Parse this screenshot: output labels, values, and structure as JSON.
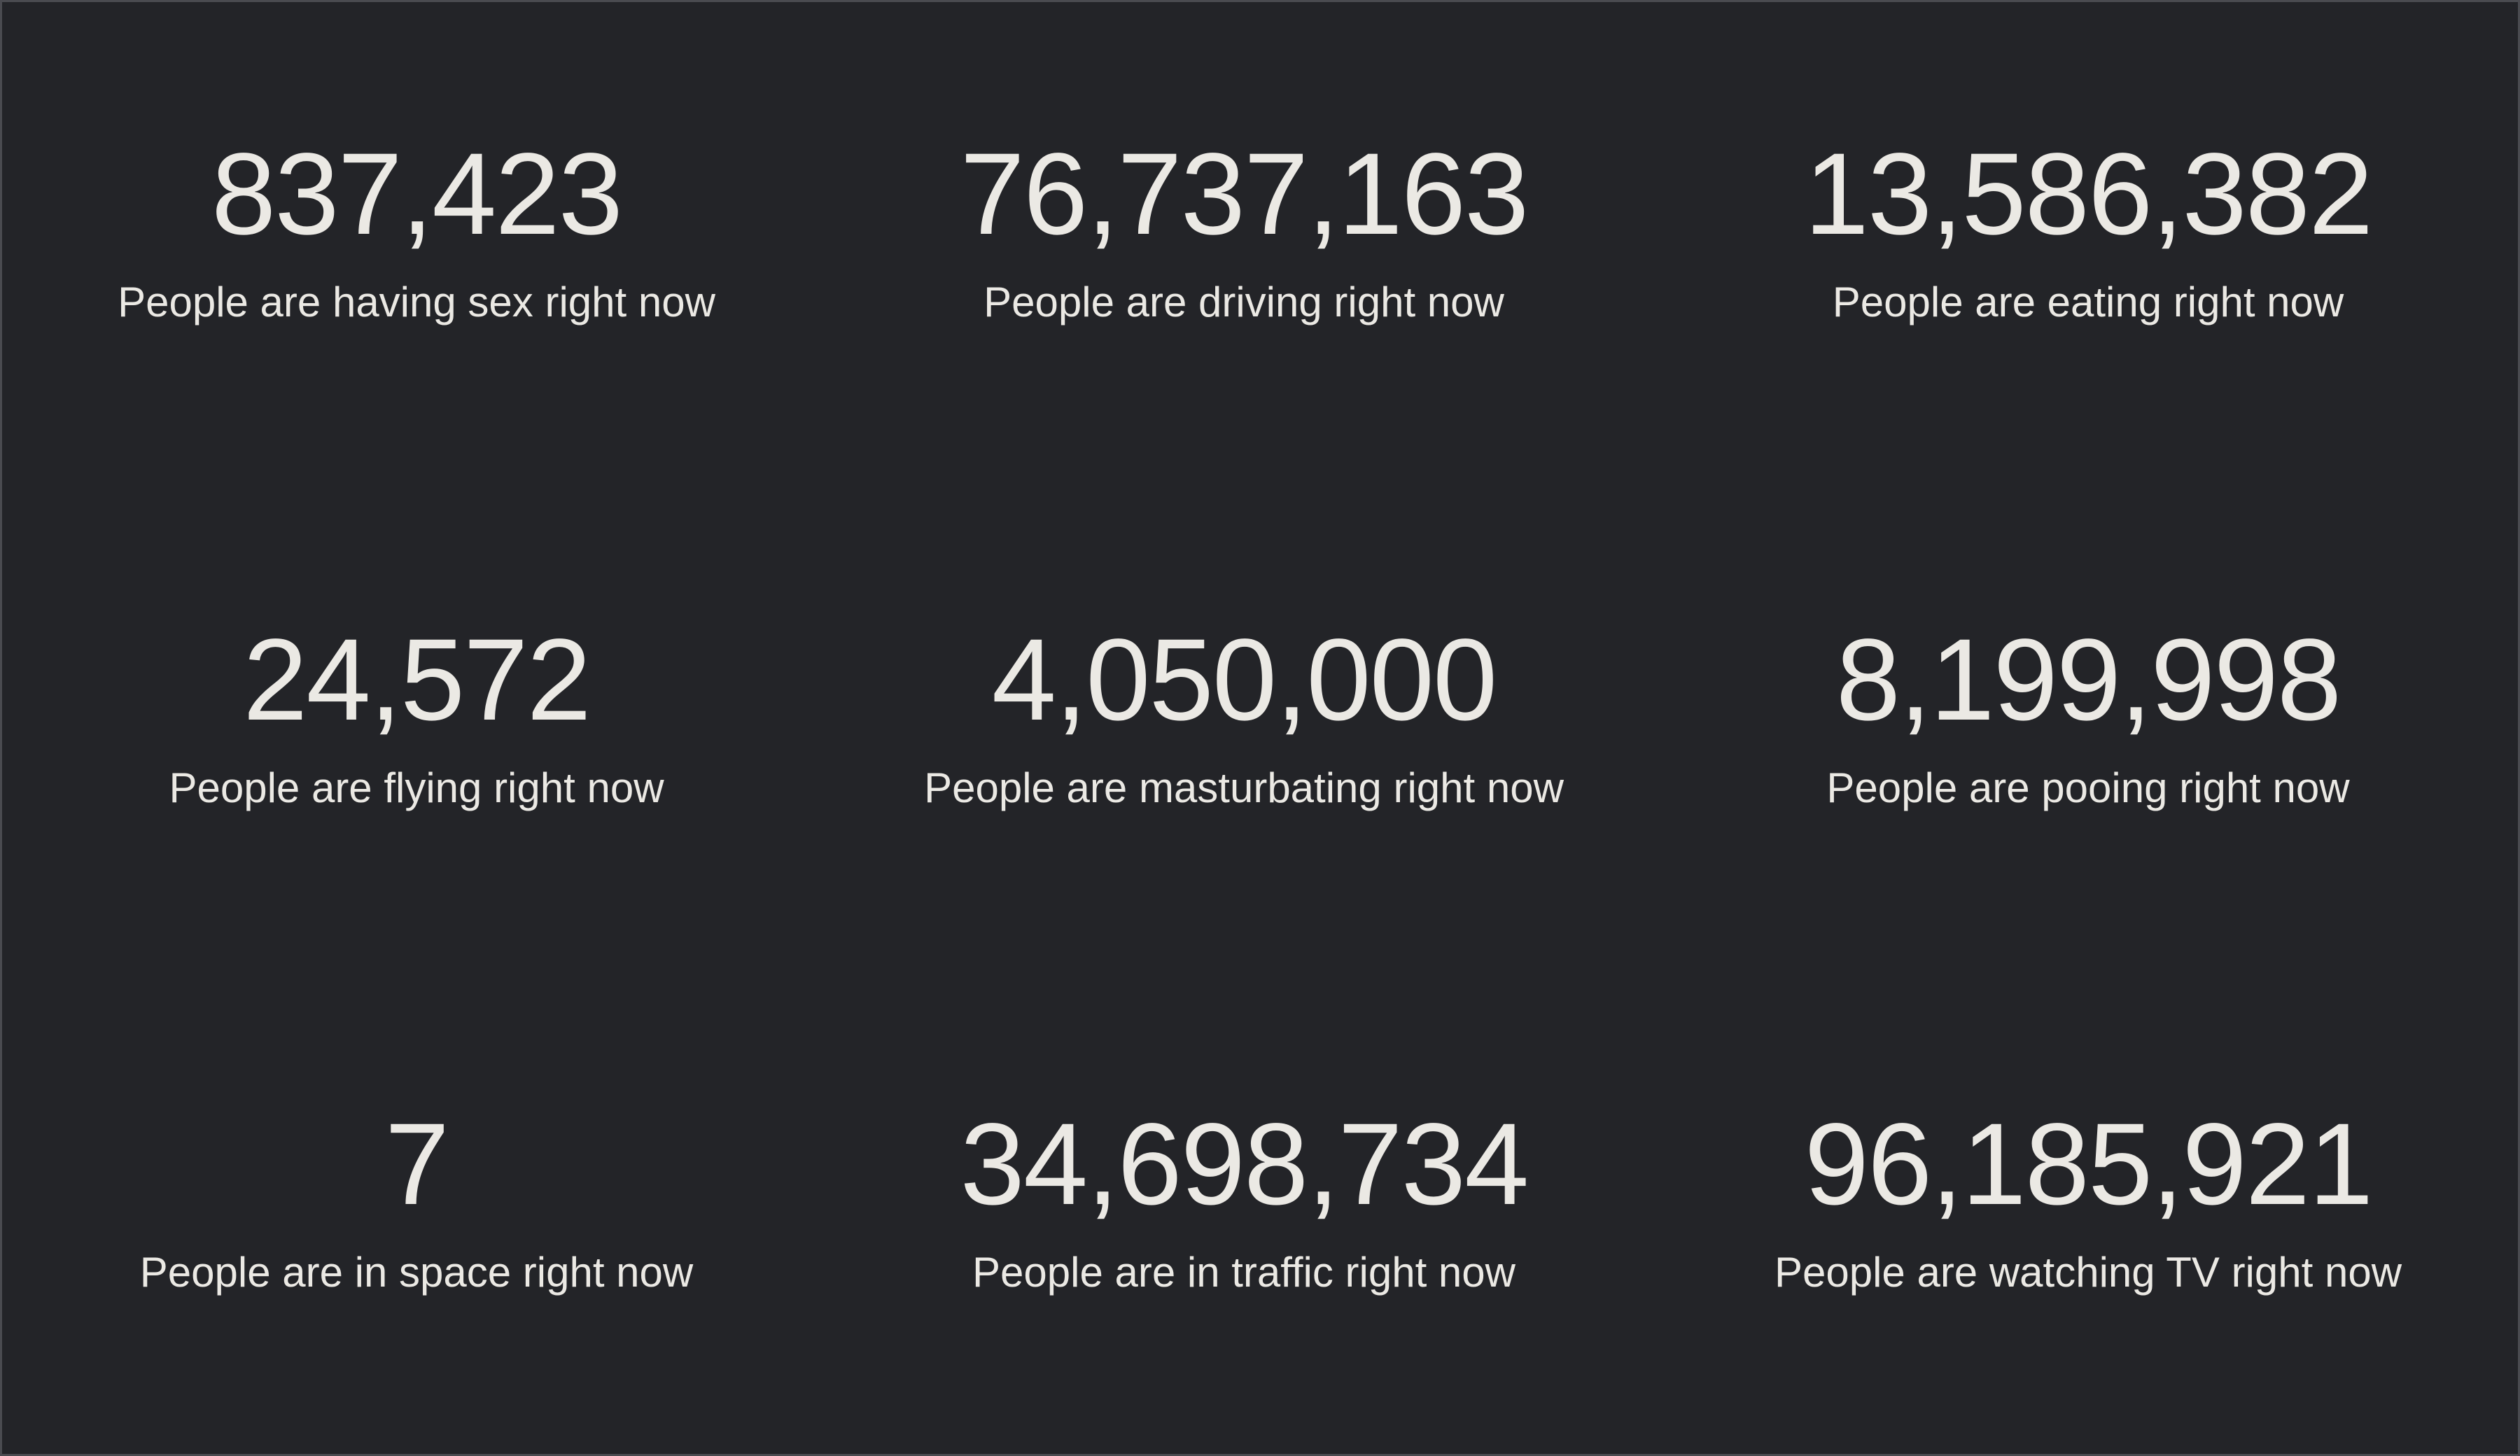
{
  "stats": [
    {
      "value": "837,423",
      "label": "People are having sex right now"
    },
    {
      "value": "76,737,163",
      "label": "People are driving right now"
    },
    {
      "value": "13,586,382",
      "label": "People are eating right now"
    },
    {
      "value": "24,572",
      "label": "People are flying right now"
    },
    {
      "value": "4,050,000",
      "label": "People are masturbating right now"
    },
    {
      "value": "8,199,998",
      "label": "People are pooing right now"
    },
    {
      "value": "7",
      "label": "People are in space right now"
    },
    {
      "value": "34,698,734",
      "label": "People are in traffic right now"
    },
    {
      "value": "96,185,921",
      "label": "People are watching TV right now"
    }
  ],
  "colors": {
    "background": "#232428",
    "text": "#ebe9e4",
    "border": "#4a4b50"
  }
}
